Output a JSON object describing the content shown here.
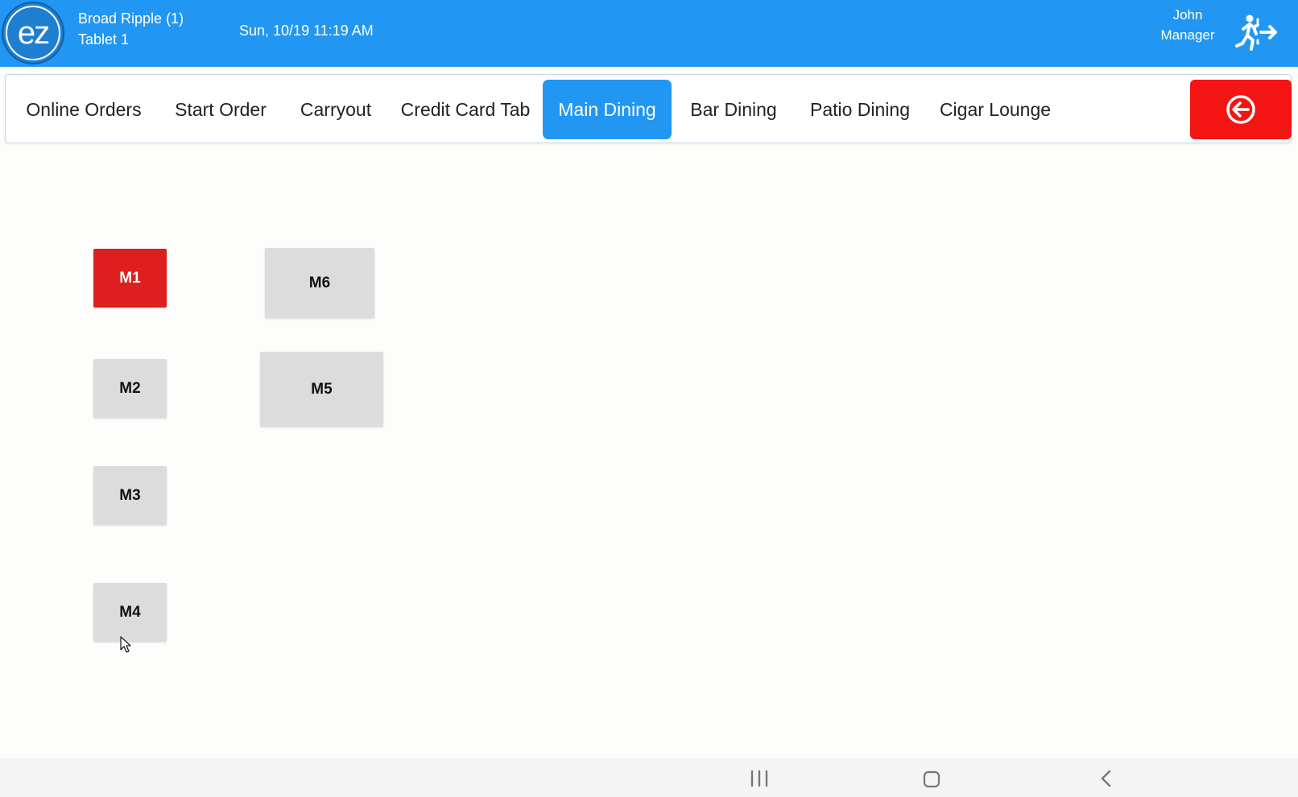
{
  "header": {
    "location": "Broad Ripple (1)",
    "device": "Tablet 1",
    "datetime": "Sun, 10/19 11:19 AM",
    "user_name": "John",
    "user_role": "Manager",
    "logo_text": "ez",
    "logout_icon": "exit-running-person-icon"
  },
  "tabs": [
    {
      "label": "Online Orders",
      "active": false
    },
    {
      "label": "Start Order",
      "active": false
    },
    {
      "label": "Carryout",
      "active": false
    },
    {
      "label": "Credit Card Tab",
      "active": false
    },
    {
      "label": "Main Dining",
      "active": true
    },
    {
      "label": "Bar Dining",
      "active": false
    },
    {
      "label": "Patio Dining",
      "active": false
    },
    {
      "label": "Cigar Lounge",
      "active": false
    }
  ],
  "back_button_icon": "circle-arrow-left-icon",
  "tables": [
    {
      "label": "M1",
      "status": "occupied"
    },
    {
      "label": "M2",
      "status": "available"
    },
    {
      "label": "M3",
      "status": "available"
    },
    {
      "label": "M4",
      "status": "available"
    },
    {
      "label": "M5",
      "status": "available"
    },
    {
      "label": "M6",
      "status": "available"
    }
  ],
  "colors": {
    "header_bg": "#2196f3",
    "active_tab": "#2196f3",
    "back_button": "#f51414",
    "occupied_table": "#dd1f1f",
    "available_table": "#dcdcdc"
  },
  "system_nav": [
    "recent-apps-icon",
    "home-icon",
    "back-icon"
  ]
}
